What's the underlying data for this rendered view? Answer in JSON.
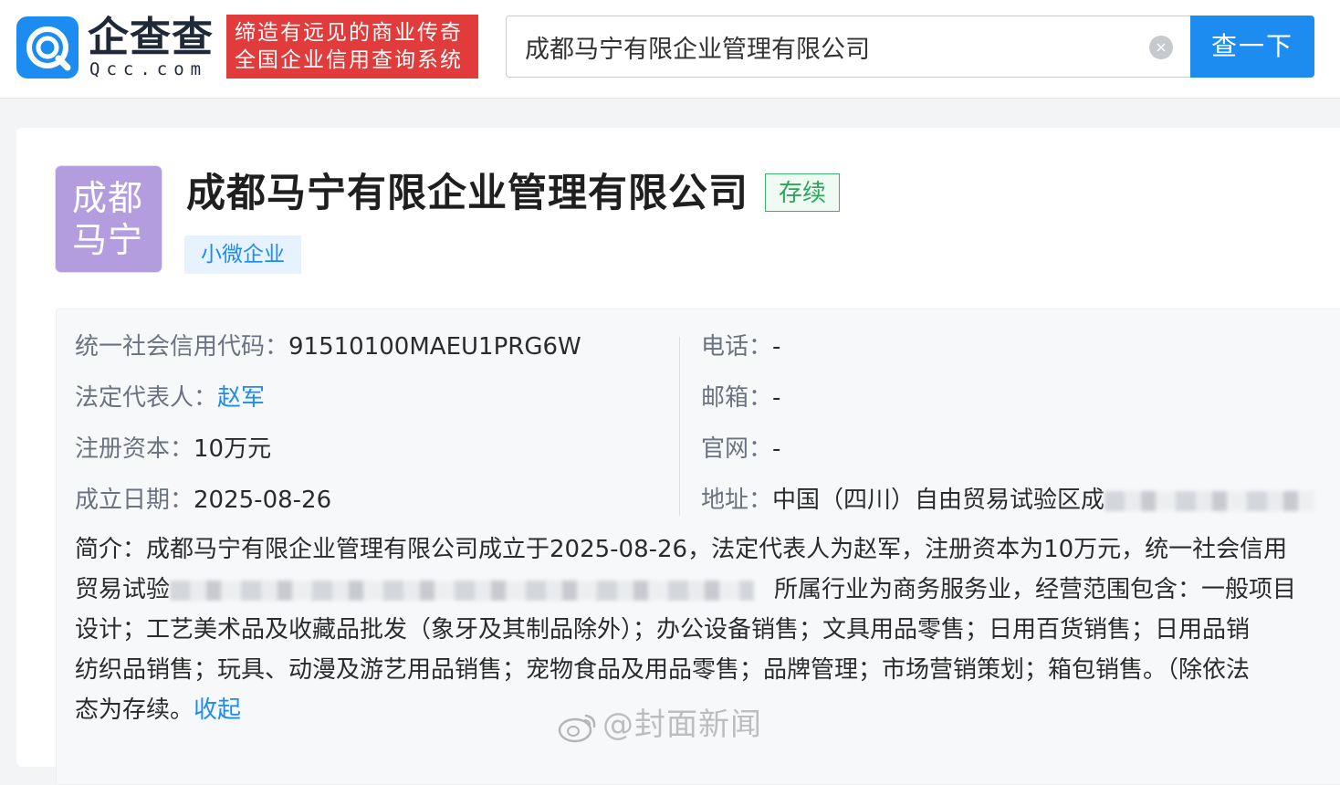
{
  "header": {
    "logo_cn": "企查查",
    "logo_en": "Qcc.com",
    "slogan_line1": "缔造有远见的商业传奇",
    "slogan_line2": "全国企业信用查询系统",
    "search_value": "成都马宁有限企业管理有限公司",
    "search_button": "查一下",
    "clear_icon": "×"
  },
  "company": {
    "avatar_line1": "成都",
    "avatar_line2": "马宁",
    "name": "成都马宁有限企业管理有限公司",
    "status": "存续",
    "scale_tag": "小微企业"
  },
  "info": {
    "credit_code_label": "统一社会信用代码：",
    "credit_code": "91510100MAEU1PRG6W",
    "legal_rep_label": "法定代表人：",
    "legal_rep": "赵军",
    "capital_label": "注册资本：",
    "capital": "10万元",
    "founded_label": "成立日期：",
    "founded": "2025-08-26",
    "phone_label": "电话：",
    "phone": "-",
    "email_label": "邮箱：",
    "email": "-",
    "website_label": "官网：",
    "website": "-",
    "address_label": "地址：",
    "address": "中国（四川）自由贸易试验区成"
  },
  "description": {
    "line1": "简介：成都马宁有限企业管理有限公司成立于2025-08-26，法定代表人为赵军，注册资本为10万元，统一社会信用",
    "line2_start": "贸易试验",
    "line2_end": "所属行业为商务服务业，经营范围包含：一般项目",
    "line3": "设计；工艺美术品及收藏品批发（象牙及其制品除外）；办公设备销售；文具用品零售；日用百货销售；日用品销",
    "line4": "纺织品销售；玩具、动漫及游艺用品销售；宠物食品及用品零售；品牌管理；市场营销策划；箱包销售。（除依法",
    "line5": "态为存续。",
    "collapse": "收起"
  },
  "watermark": {
    "text": "@封面新闻"
  },
  "colors": {
    "accent": "#1d8cf0",
    "slogan_bg": "#e23b3b",
    "status_green": "#2fa55b",
    "avatar_bg": "#b39ddf"
  }
}
